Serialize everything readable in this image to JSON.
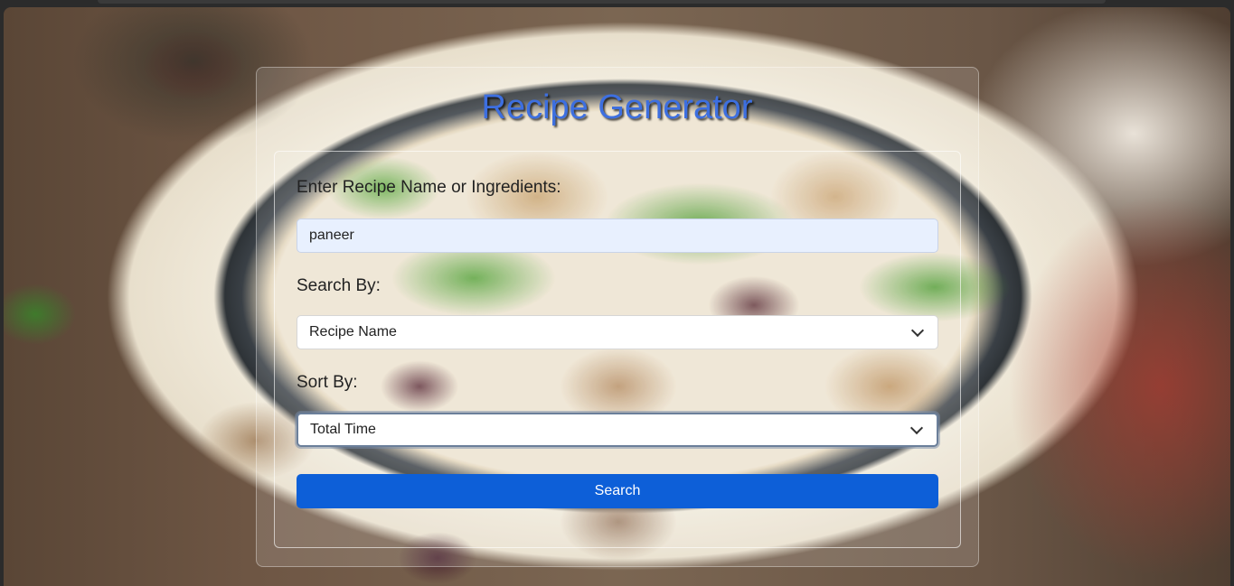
{
  "page": {
    "title": "Recipe Generator"
  },
  "form": {
    "query_label": "Enter Recipe Name or Ingredients:",
    "query_value": "paneer",
    "search_by_label": "Search By:",
    "search_by_selected": "Recipe Name",
    "sort_by_label": "Sort By:",
    "sort_by_selected": "Total Time",
    "search_button": "Search"
  },
  "colors": {
    "title": "#3d6fe0",
    "button": "#0d5fd8",
    "input_bg": "#e8f0fe"
  },
  "icons": {
    "select_arrow": "chevron-down-icon"
  }
}
